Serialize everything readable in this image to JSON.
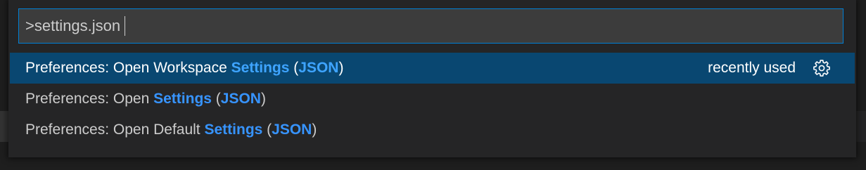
{
  "quick_open": {
    "input_value": ">settings.json",
    "items": [
      {
        "prefix": "Preferences: Open Workspace ",
        "match1": "Settings",
        "mid": " (",
        "match2": "JSON",
        "suffix": ")",
        "detail": "recently used",
        "action_icon": "gear-icon",
        "selected": true
      },
      {
        "prefix": "Preferences: Open ",
        "match1": "Settings",
        "mid": " (",
        "match2": "JSON",
        "suffix": ")",
        "selected": false
      },
      {
        "prefix": "Preferences: Open Default ",
        "match1": "Settings",
        "mid": " (",
        "match2": "JSON",
        "suffix": ")",
        "selected": false
      }
    ]
  },
  "colors": {
    "background": "#1e1e1e",
    "widget": "#252526",
    "input": "#3c3c3c",
    "focus_border": "#007fd4",
    "selection": "#094771",
    "highlight": "#3794ff",
    "text": "#cccccc"
  }
}
